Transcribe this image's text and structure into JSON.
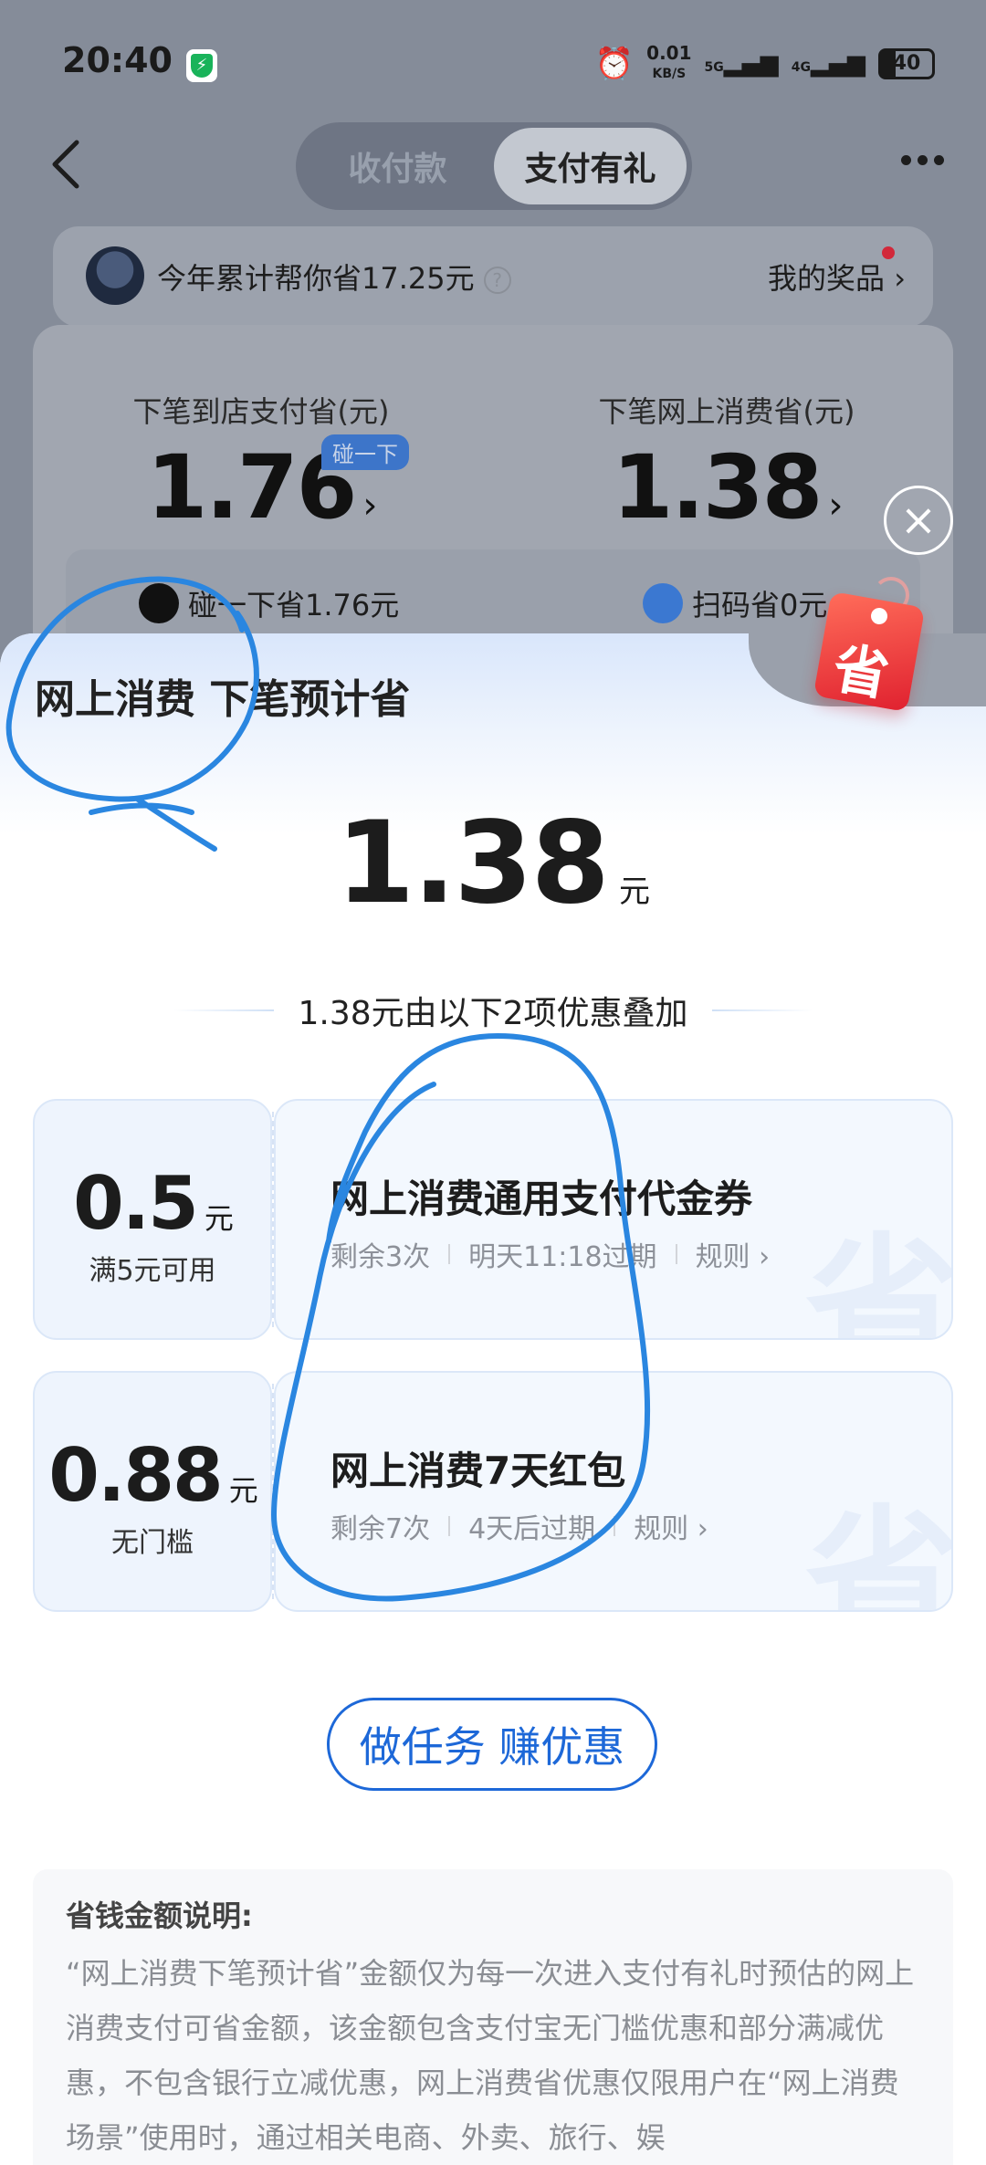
{
  "status": {
    "time": "20:40",
    "net_speed": "0.01",
    "net_unit": "KB/S",
    "sig1": "5G",
    "sig2": "4G",
    "battery": "40"
  },
  "header": {
    "tabs": [
      "收付款",
      "支付有礼"
    ],
    "active_tab": "支付有礼"
  },
  "savings": {
    "text": "今年累计帮你省17.25元",
    "help": "?",
    "prizes": "我的奖品 ›"
  },
  "predict": {
    "store_caption": "下笔到店支付省(元)",
    "store_value": "1.76",
    "online_caption": "下笔网上消费省(元)",
    "online_value": "1.38",
    "arrow": "›",
    "tap_badge": "碰一下",
    "tap_saving": "碰一下省1.76元",
    "scan_saving": "扫码省0元"
  },
  "sheet": {
    "title": "网上消费 下笔预计省",
    "amount": "1.38",
    "unit": "元",
    "tag_text": "省",
    "stack_text": "1.38元由以下2项优惠叠加",
    "coupons": [
      {
        "amount": "0.5",
        "unit": "元",
        "condition": "满5元可用",
        "title": "网上消费通用支付代金券",
        "remaining": "剩余3次",
        "expiry": "明天11:18过期",
        "rules": "规则 ›",
        "watermark": "省"
      },
      {
        "amount": "0.88",
        "unit": "元",
        "condition": "无门槛",
        "title": "网上消费7天红包",
        "remaining": "剩余7次",
        "expiry": "4天后过期",
        "rules": "规则 ›",
        "watermark": "省"
      }
    ],
    "task_button": "做任务 赚优惠",
    "explain_title": "省钱金额说明:",
    "explain_body": "“网上消费下笔预计省”金额仅为每一次进入支付有礼时预估的网上消费支付可省金额，该金额包含支付宝无门槛优惠和部分满减优惠，不包含银行立减优惠，网上消费省优惠仅限用户在“网上消费场景”使用时，通过相关电商、外卖、旅行、娱"
  },
  "colors": {
    "accent": "#1d68d8",
    "scribble": "#2a86e0",
    "tag_red": "#e0212f"
  }
}
